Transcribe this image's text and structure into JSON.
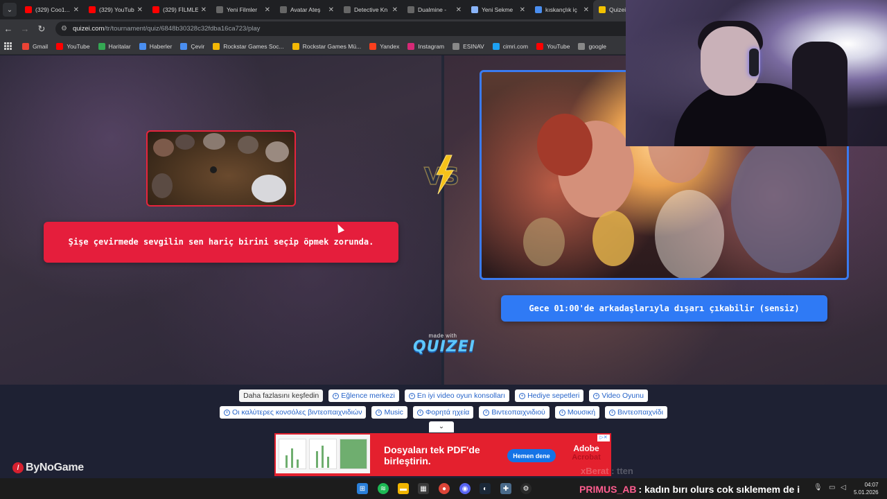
{
  "browser": {
    "tabs": [
      {
        "title": "(329) Coo1...",
        "fav_color": "#ff0000"
      },
      {
        "title": "(329) YouTub",
        "fav_color": "#ff0000"
      },
      {
        "title": "(329) FİLMLE",
        "fav_color": "#ff0000"
      },
      {
        "title": "Yeni Filmler",
        "fav_color": "#666666"
      },
      {
        "title": "Avatar Ateş",
        "fav_color": "#666666"
      },
      {
        "title": "Detective Kn",
        "fav_color": "#666666"
      },
      {
        "title": "Dualmine -",
        "fav_color": "#666666"
      },
      {
        "title": "Yeni Sekme",
        "fav_color": "#8ab4f8"
      },
      {
        "title": "kıskançlık iç",
        "fav_color": "#4a8ef0"
      },
      {
        "title": "Quizei",
        "fav_color": "#f2c200"
      }
    ],
    "url_host": "quizei.com",
    "url_path": "/tr/tournament/quiz/6848b30328c32fdba16ca723/play",
    "bookmarks": [
      {
        "label": "Gmail",
        "icon": "gmail-icon",
        "color": "#ea4335"
      },
      {
        "label": "YouTube",
        "icon": "youtube-icon",
        "color": "#ff0000"
      },
      {
        "label": "Haritalar",
        "icon": "maps-icon",
        "color": "#34a853"
      },
      {
        "label": "Haberler",
        "icon": "news-icon",
        "color": "#4a8ef0"
      },
      {
        "label": "Çevir",
        "icon": "translate-icon",
        "color": "#4a8ef0"
      },
      {
        "label": "Rockstar Games Soc...",
        "icon": "rockstar-icon",
        "color": "#f2b705"
      },
      {
        "label": "Rockstar Games Mü...",
        "icon": "rockstar-icon",
        "color": "#f2b705"
      },
      {
        "label": "Yandex",
        "icon": "yandex-icon",
        "color": "#fc3f1d"
      },
      {
        "label": "Instagram",
        "icon": "instagram-icon",
        "color": "#d62976"
      },
      {
        "label": "ESINAV",
        "icon": "esinav-icon",
        "color": "#888888"
      },
      {
        "label": "cimri.com",
        "icon": "cimri-icon",
        "color": "#1da1f2"
      },
      {
        "label": "YouTube",
        "icon": "youtube-icon",
        "color": "#ff0000"
      },
      {
        "label": "google",
        "icon": "google-icon",
        "color": "#888888"
      }
    ]
  },
  "quiz": {
    "left_option": "Şişe çevirmede sevgilin sen hariç birini seçip öpmek zorunda.",
    "right_option": "Gece 01:00'de arkadaşlarıyla dışarı çıkabilir (sensiz)",
    "vs_label": "VS",
    "made_with": "made with",
    "brand": "QUIZEI",
    "left_color": "#e51e3c",
    "right_color": "#2f7af5"
  },
  "explore": {
    "label": "Daha fazlasını keşfedin",
    "row1": [
      "Eğlence merkezi",
      "En iyi video oyun konsolları",
      "Hediye sepetleri",
      "Video Oyunu"
    ],
    "row2": [
      "Οι καλύτερες κονσόλες βιντεοπαιχνιδιών",
      "Music",
      "Φορητά ηχεία",
      "Βιντεοπαιχνιδιού",
      "Μουσική",
      "Βιντεοπαιχνίδι"
    ],
    "collapse_icon": "chevron-down-icon"
  },
  "ad": {
    "headline": "Dosyaları tek PDF'de birleştirin.",
    "cta": "Hemen dene",
    "brand_line1": "Adobe",
    "brand_line2": "Acrobat"
  },
  "overlay": {
    "logo_text": "ByNoGame",
    "chat_faded": "xBerat : tten",
    "chat_user": "PRIMUS_AB",
    "chat_message": ": kadın bırı olurs cok sıklemem de i"
  },
  "taskbar": {
    "time": "04:07",
    "date": "5.01.2026"
  }
}
